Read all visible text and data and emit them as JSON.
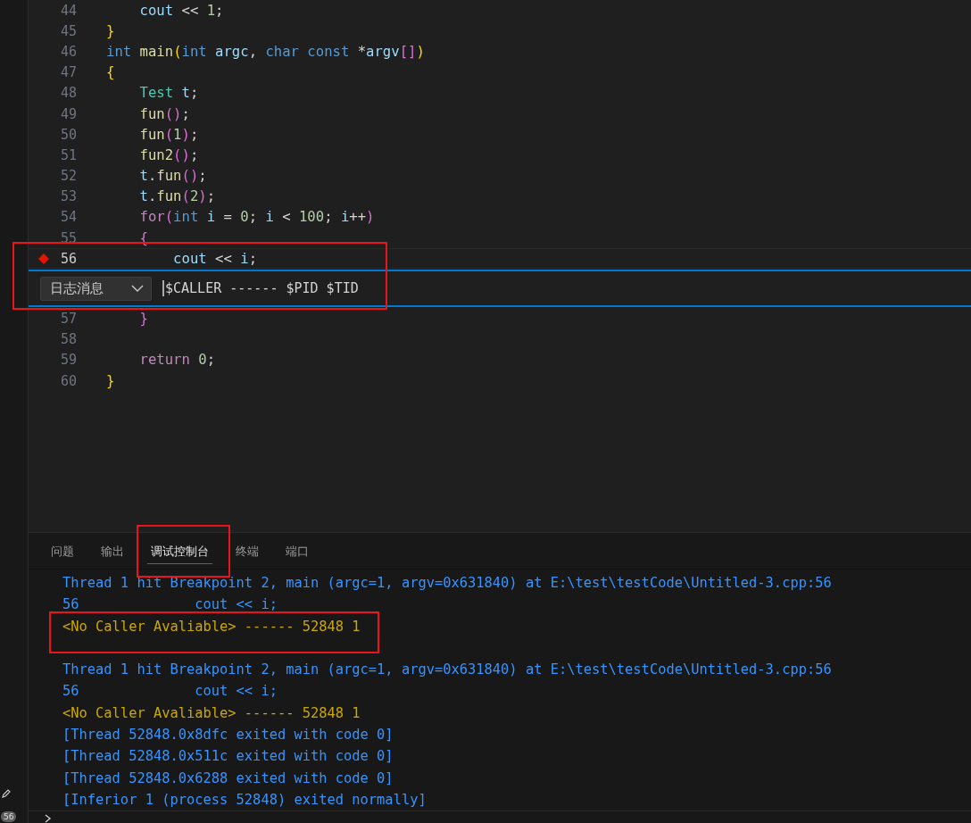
{
  "activity_bar": {
    "badge": "56"
  },
  "editor": {
    "lines": [
      {
        "number": "44",
        "breakpoint": false,
        "current": false,
        "tokens": [
          {
            "kind": "var",
            "text": "    cout"
          },
          {
            "kind": "plain",
            "text": " << "
          },
          {
            "kind": "num",
            "text": "1"
          },
          {
            "kind": "plain",
            "text": ";"
          }
        ]
      },
      {
        "number": "45",
        "breakpoint": false,
        "current": false,
        "tokens": [
          {
            "kind": "b1",
            "text": "}"
          }
        ]
      },
      {
        "number": "46",
        "breakpoint": false,
        "current": false,
        "tokens": [
          {
            "kind": "kw",
            "text": "int"
          },
          {
            "kind": "fn",
            "text": " main"
          },
          {
            "kind": "b1",
            "text": "("
          },
          {
            "kind": "kw",
            "text": "int"
          },
          {
            "kind": "var",
            "text": " argc"
          },
          {
            "kind": "plain",
            "text": ", "
          },
          {
            "kind": "kw",
            "text": "char const"
          },
          {
            "kind": "plain",
            "text": " *"
          },
          {
            "kind": "var",
            "text": "argv"
          },
          {
            "kind": "b2",
            "text": "[]"
          },
          {
            "kind": "b1",
            "text": ")"
          }
        ]
      },
      {
        "number": "47",
        "breakpoint": false,
        "current": false,
        "tokens": [
          {
            "kind": "b1",
            "text": "{"
          }
        ]
      },
      {
        "number": "48",
        "breakpoint": false,
        "current": false,
        "tokens": [
          {
            "kind": "type",
            "text": "    Test"
          },
          {
            "kind": "var",
            "text": " t"
          },
          {
            "kind": "plain",
            "text": ";"
          }
        ]
      },
      {
        "number": "49",
        "breakpoint": false,
        "current": false,
        "tokens": [
          {
            "kind": "fn",
            "text": "    fun"
          },
          {
            "kind": "b2",
            "text": "()"
          },
          {
            "kind": "plain",
            "text": ";"
          }
        ]
      },
      {
        "number": "50",
        "breakpoint": false,
        "current": false,
        "tokens": [
          {
            "kind": "fn",
            "text": "    fun"
          },
          {
            "kind": "b2",
            "text": "("
          },
          {
            "kind": "num",
            "text": "1"
          },
          {
            "kind": "b2",
            "text": ")"
          },
          {
            "kind": "plain",
            "text": ";"
          }
        ]
      },
      {
        "number": "51",
        "breakpoint": false,
        "current": false,
        "tokens": [
          {
            "kind": "fn",
            "text": "    fun2"
          },
          {
            "kind": "b2",
            "text": "()"
          },
          {
            "kind": "plain",
            "text": ";"
          }
        ]
      },
      {
        "number": "52",
        "breakpoint": false,
        "current": false,
        "tokens": [
          {
            "kind": "var",
            "text": "    t"
          },
          {
            "kind": "plain",
            "text": "."
          },
          {
            "kind": "fn",
            "text": "fun"
          },
          {
            "kind": "b2",
            "text": "()"
          },
          {
            "kind": "plain",
            "text": ";"
          }
        ]
      },
      {
        "number": "53",
        "breakpoint": false,
        "current": false,
        "tokens": [
          {
            "kind": "var",
            "text": "    t"
          },
          {
            "kind": "plain",
            "text": "."
          },
          {
            "kind": "fn",
            "text": "fun"
          },
          {
            "kind": "b2",
            "text": "("
          },
          {
            "kind": "num",
            "text": "2"
          },
          {
            "kind": "b2",
            "text": ")"
          },
          {
            "kind": "plain",
            "text": ";"
          }
        ]
      },
      {
        "number": "54",
        "breakpoint": false,
        "current": false,
        "tokens": [
          {
            "kind": "ctrl",
            "text": "    for"
          },
          {
            "kind": "b2",
            "text": "("
          },
          {
            "kind": "kw",
            "text": "int"
          },
          {
            "kind": "var",
            "text": " i"
          },
          {
            "kind": "plain",
            "text": " = "
          },
          {
            "kind": "num",
            "text": "0"
          },
          {
            "kind": "plain",
            "text": "; "
          },
          {
            "kind": "var",
            "text": "i"
          },
          {
            "kind": "plain",
            "text": " < "
          },
          {
            "kind": "num",
            "text": "100"
          },
          {
            "kind": "plain",
            "text": "; "
          },
          {
            "kind": "var",
            "text": "i"
          },
          {
            "kind": "plain",
            "text": "++"
          },
          {
            "kind": "b2",
            "text": ")"
          }
        ]
      },
      {
        "number": "55",
        "breakpoint": false,
        "current": false,
        "tokens": [
          {
            "kind": "b2",
            "text": "    {"
          }
        ]
      },
      {
        "number": "56",
        "breakpoint": true,
        "current": true,
        "tokens": [
          {
            "kind": "var",
            "text": "        cout"
          },
          {
            "kind": "plain",
            "text": " << "
          },
          {
            "kind": "var",
            "text": "i"
          },
          {
            "kind": "plain",
            "text": ";"
          }
        ]
      },
      {
        "number": "57",
        "breakpoint": false,
        "current": false,
        "tokens": [
          {
            "kind": "b2",
            "text": "    }"
          }
        ]
      },
      {
        "number": "58",
        "breakpoint": false,
        "current": false
      },
      {
        "number": "59",
        "breakpoint": false,
        "current": false,
        "tokens": [
          {
            "kind": "ctrl",
            "text": "    return"
          },
          {
            "kind": "num",
            "text": " 0"
          },
          {
            "kind": "plain",
            "text": ";"
          }
        ]
      },
      {
        "number": "60",
        "breakpoint": false,
        "current": false,
        "tokens": [
          {
            "kind": "b1",
            "text": "}"
          }
        ]
      }
    ],
    "breakpoint_widget": {
      "type": "日志消息",
      "message": "$CALLER ------ $PID $TID"
    }
  },
  "panel": {
    "tabs": [
      {
        "label": "问题",
        "selected": false
      },
      {
        "label": "输出",
        "selected": false
      },
      {
        "label": "调试控制台",
        "selected": true
      },
      {
        "label": "终端",
        "selected": false
      },
      {
        "label": "端口",
        "selected": false
      }
    ],
    "console": [
      {
        "lines": [
          {
            "kind": "info",
            "text": "Thread 1 hit Breakpoint 2, main (argc=1, argv=0x631840) at E:\\test\\testCode\\Untitled-3.cpp:56"
          },
          {
            "kind": "info",
            "text": "56              cout << i;"
          },
          {
            "kind": "log",
            "text": "<No Caller Avaliable> ------ 52848 1"
          }
        ]
      },
      {
        "lines": [
          {
            "kind": "info",
            "text": "Thread 1 hit Breakpoint 2, main (argc=1, argv=0x631840) at E:\\test\\testCode\\Untitled-3.cpp:56"
          },
          {
            "kind": "info",
            "text": "56              cout << i;"
          },
          {
            "kind": "log",
            "text": "<No Caller Avaliable> ------ 52848 1"
          },
          {
            "kind": "info",
            "text": "[Thread 52848.0x8dfc exited with code 0]"
          },
          {
            "kind": "info",
            "text": "[Thread 52848.0x511c exited with code 0]"
          },
          {
            "kind": "info",
            "text": "[Thread 52848.0x6288 exited with code 0]"
          },
          {
            "kind": "info",
            "text": "[Inferior 1 (process 52848) exited normally]"
          }
        ]
      }
    ]
  }
}
